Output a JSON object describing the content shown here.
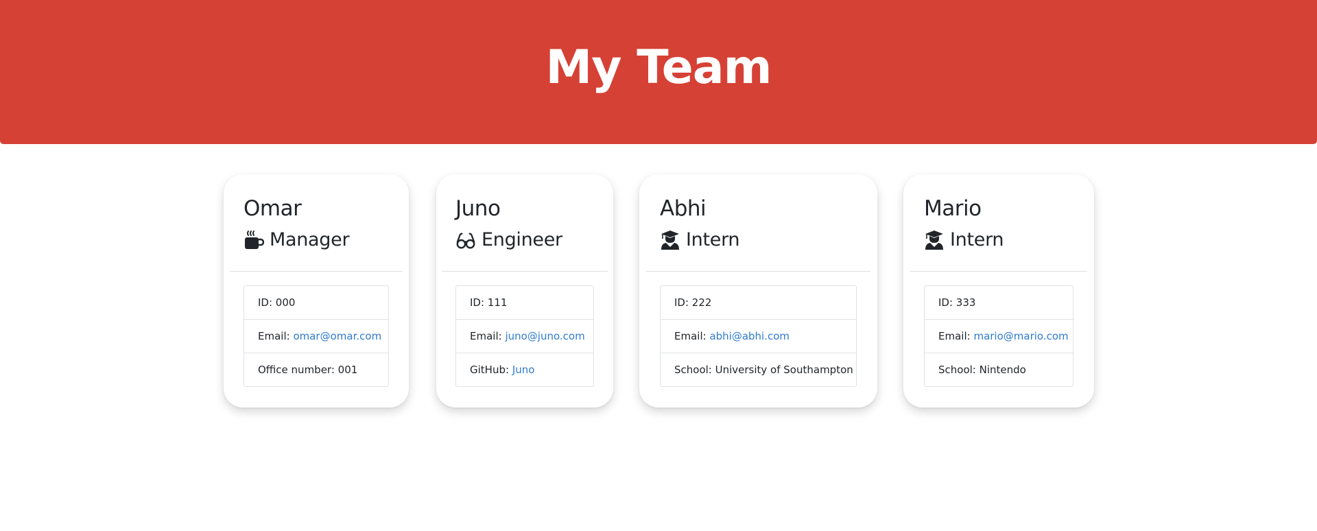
{
  "header": {
    "title": "My Team"
  },
  "colors": {
    "header_bg": "#d64135",
    "link": "#2f7bd2"
  },
  "team": [
    {
      "name": "Omar",
      "role": "Manager",
      "role_icon": "mug-hot-icon",
      "id_text": "ID: 000",
      "email_label": "Email: ",
      "email": "omar@omar.com",
      "extra_label": "Office number: 001",
      "extra_link": ""
    },
    {
      "name": "Juno",
      "role": "Engineer",
      "role_icon": "glasses-icon",
      "id_text": "ID: 111",
      "email_label": "Email: ",
      "email": "juno@juno.com",
      "extra_label": "GitHub: ",
      "extra_link": "Juno"
    },
    {
      "name": "Abhi",
      "role": "Intern",
      "role_icon": "user-graduate-icon",
      "id_text": "ID: 222",
      "email_label": "Email: ",
      "email": "abhi@abhi.com",
      "extra_label": "School: University of Southampton",
      "extra_link": ""
    },
    {
      "name": "Mario",
      "role": "Intern",
      "role_icon": "user-graduate-icon",
      "id_text": "ID: 333",
      "email_label": "Email: ",
      "email": "mario@mario.com",
      "extra_label": "School: Nintendo",
      "extra_link": ""
    }
  ]
}
